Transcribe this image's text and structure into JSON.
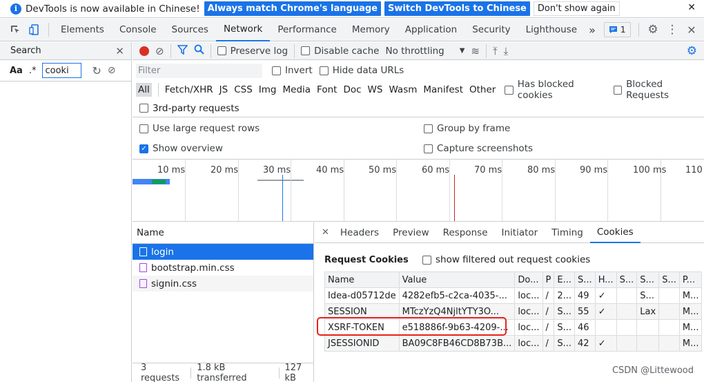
{
  "infobar": {
    "message": "DevTools is now available in Chinese!",
    "btn_match": "Always match Chrome's language",
    "btn_switch": "Switch DevTools to Chinese",
    "btn_dismiss": "Don't show again",
    "close": "✕"
  },
  "tabs": [
    "Elements",
    "Console",
    "Sources",
    "Network",
    "Performance",
    "Memory",
    "Application",
    "Security",
    "Lighthouse"
  ],
  "active_tab": "Network",
  "more_tabs": "»",
  "issues_count": "1",
  "search": {
    "title": "Search",
    "close": "✕",
    "case_label": "Aa",
    "regex_label": ".*",
    "query": "cooki"
  },
  "network_toolbar": {
    "preserve_log": "Preserve log",
    "disable_cache": "Disable cache",
    "throttling": "No throttling"
  },
  "filter": {
    "placeholder": "Filter",
    "invert": "Invert",
    "hide_data_urls": "Hide data URLs",
    "types": [
      "All",
      "Fetch/XHR",
      "JS",
      "CSS",
      "Img",
      "Media",
      "Font",
      "Doc",
      "WS",
      "Wasm",
      "Manifest",
      "Other"
    ],
    "blocked_cookies": "Has blocked cookies",
    "blocked_requests": "Blocked Requests",
    "third_party": "3rd-party requests"
  },
  "settings": {
    "large_rows": "Use large request rows",
    "group_by_frame": "Group by frame",
    "show_overview": "Show overview",
    "capture_screenshots": "Capture screenshots"
  },
  "overview": {
    "ticks": [
      "10 ms",
      "20 ms",
      "30 ms",
      "40 ms",
      "50 ms",
      "60 ms",
      "70 ms",
      "80 ms",
      "90 ms",
      "100 ms",
      "110 ms"
    ],
    "colors": {
      "dom_content": "#1a73e8",
      "load": "#c5221f",
      "bar_blue": "#4285f4",
      "bar_green": "#0f9d58"
    }
  },
  "requests": {
    "header": "Name",
    "items": [
      {
        "name": "login",
        "type": "doc"
      },
      {
        "name": "bootstrap.min.css",
        "type": "css"
      },
      {
        "name": "signin.css",
        "type": "css"
      }
    ],
    "count": "3 requests",
    "transferred": "1.8 kB transferred",
    "resources": "127 kB"
  },
  "detail": {
    "close": "✕",
    "tabs": [
      "Headers",
      "Preview",
      "Response",
      "Initiator",
      "Timing",
      "Cookies"
    ],
    "active_tab": "Cookies",
    "section_title": "Request Cookies",
    "show_filtered": "show filtered out request cookies",
    "columns": [
      "Name",
      "Value",
      "Do...",
      "P",
      "E...",
      "S...",
      "H...",
      "S...",
      "S...",
      "S...",
      "P..."
    ],
    "rows": [
      [
        "Idea-d05712de",
        "4282efb5-c2ca-4035-...",
        "loc...",
        "/",
        "2...",
        "49",
        "✓",
        "",
        "S...",
        "",
        "M..."
      ],
      [
        "SESSION",
        "MTczYzQ4NjltYTY3O...",
        "loc...",
        "/",
        "S...",
        "55",
        "✓",
        "",
        "Lax",
        "",
        "M..."
      ],
      [
        "XSRF-TOKEN",
        "e518886f-9b63-4209-...",
        "loc...",
        "/",
        "S...",
        "46",
        "",
        "",
        "",
        "",
        "M..."
      ],
      [
        "JSESSIONID",
        "BA09C8FB46CD8B73B...",
        "loc...",
        "/",
        "S...",
        "42",
        "✓",
        "",
        "",
        "",
        "M..."
      ]
    ]
  },
  "watermark": "CSDN @Littewood"
}
